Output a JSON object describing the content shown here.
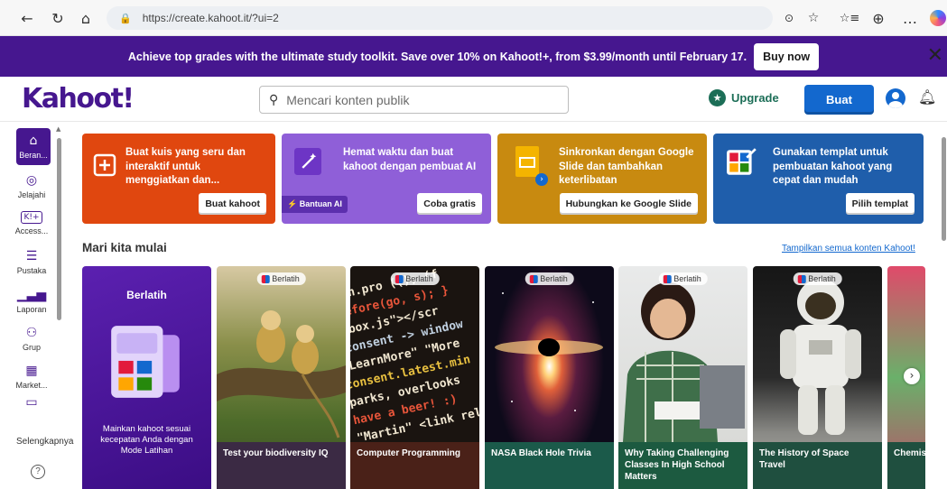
{
  "browser": {
    "url": "https://create.kahoot.it/?ui=2"
  },
  "promo": {
    "text": "Achieve top grades with the ultimate study toolkit. Save over 10% on Kahoot!+, from $3.99/month until February 17.",
    "button": "Buy now"
  },
  "header": {
    "logo": "Kahoot!",
    "search_placeholder": "Mencari konten publik",
    "upgrade": "Upgrade",
    "create": "Buat"
  },
  "sidebar": {
    "items": [
      {
        "label": "Beran...",
        "icon": "home-icon"
      },
      {
        "label": "Jelajahi",
        "icon": "compass-icon"
      },
      {
        "label": "Access...",
        "icon": "kahoot-plus-icon"
      },
      {
        "label": "Pustaka",
        "icon": "list-icon"
      },
      {
        "label": "Laporan",
        "icon": "bar-chart-icon"
      },
      {
        "label": "Grup",
        "icon": "group-icon"
      },
      {
        "label": "Market...",
        "icon": "shop-icon"
      }
    ],
    "more": "Selengkapnya"
  },
  "cards": [
    {
      "text": "Buat kuis yang seru dan interaktif untuk menggiatkan dan...",
      "button": "Buat kahoot",
      "color": "#e0470f"
    },
    {
      "text": "Hemat waktu dan buat kahoot dengan pembuat AI",
      "button": "Coba gratis",
      "badge": "Bantuan AI",
      "color": "#8f5fd8"
    },
    {
      "text": "Sinkronkan dengan Google Slide dan tambahkan keterlibatan",
      "button": "Hubungkan ke Google Slide",
      "color": "#c88a10"
    },
    {
      "text": "Gunakan templat untuk pembuatan kahoot yang cepat dan mudah",
      "button": "Pilih templat",
      "color": "#1f5eab"
    }
  ],
  "section": {
    "title": "Mari kita mulai",
    "link": "Tampilkan semua konten Kahoot!"
  },
  "practice": {
    "title": "Berlatih",
    "text": "Mainkan kahoot sesuai kecepatan Anda dengan Mode Latihan"
  },
  "tiles": [
    {
      "title": "Test your biodiversity IQ",
      "tag": "Berlatih"
    },
    {
      "title": "Computer Programming",
      "tag": "Berlatih"
    },
    {
      "title": "NASA Black Hole Trivia",
      "tag": "Berlatih"
    },
    {
      "title": "Why Taking Challenging Classes In High School Matters",
      "tag": "Berlatih"
    },
    {
      "title": "The History of Space Travel",
      "tag": "Berlatih"
    },
    {
      "title": "Chemis",
      "tag": ""
    }
  ]
}
